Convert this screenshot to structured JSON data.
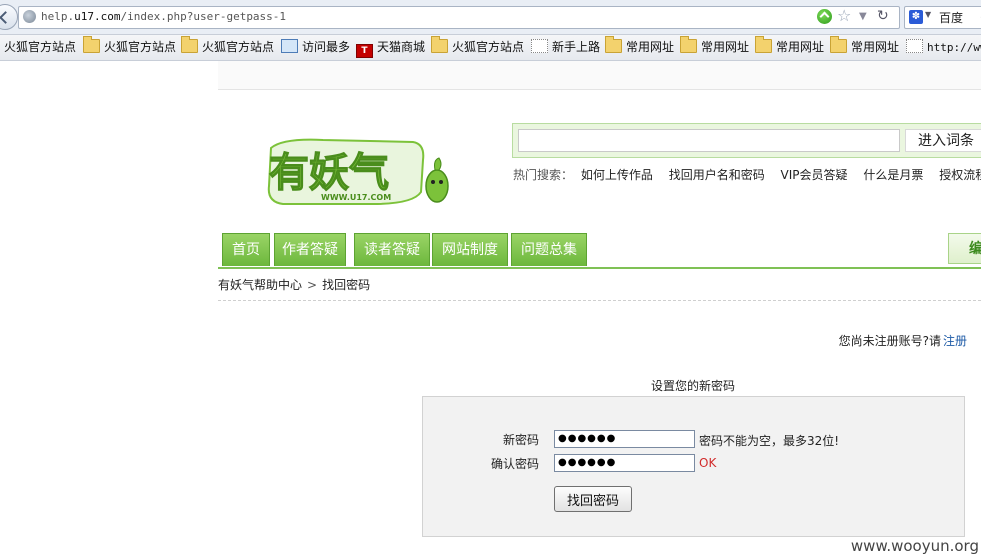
{
  "browser": {
    "url_prefix": "help.",
    "url_domain": "u17.com",
    "url_path": "/index.php?user-getpass-1",
    "search_engine": "百度",
    "search_extra": "《C"
  },
  "bookmarks": [
    {
      "label": "火狐官方站点",
      "icon": "folder-icon"
    },
    {
      "label": "火狐官方站点",
      "icon": "folder-icon"
    },
    {
      "label": "火狐官方站点",
      "icon": "folder-icon"
    },
    {
      "label": "访问最多",
      "icon": "magnifier-icon"
    },
    {
      "label": "天猫商城",
      "icon": "tmall-icon"
    },
    {
      "label": "火狐官方站点",
      "icon": "folder-icon"
    },
    {
      "label": "新手上路",
      "icon": "blank-page-icon"
    },
    {
      "label": "常用网址",
      "icon": "folder-icon"
    },
    {
      "label": "常用网址",
      "icon": "folder-icon"
    },
    {
      "label": "常用网址",
      "icon": "folder-icon"
    },
    {
      "label": "常用网址",
      "icon": "folder-icon"
    },
    {
      "label": "http://www",
      "icon": "blank-page-icon"
    }
  ],
  "logo": {
    "brand": "有妖气",
    "domain": "WWW.U17.COM",
    "color": "#7cc23a"
  },
  "search": {
    "input_value": "",
    "button_label": "进入词条"
  },
  "hot_search": {
    "label": "热门搜索：",
    "items": [
      "如何上传作品",
      "找回用户名和密码",
      "VIP会员答疑",
      "什么是月票",
      "授权流程"
    ]
  },
  "nav": {
    "tabs": [
      "首页",
      "作者答疑",
      "读者答疑",
      "网站制度",
      "问题总集"
    ],
    "edit_label": "编"
  },
  "breadcrumb": {
    "home": "有妖气帮助中心",
    "separator": ">",
    "current": "找回密码"
  },
  "register": {
    "prompt": "您尚未注册账号?请",
    "link": "注册"
  },
  "form": {
    "title": "设置您的新密码",
    "new_password_label": "新密码",
    "new_password_value": "●●●●●●",
    "new_password_hint": "密码不能为空，最多32位!",
    "confirm_label": "确认密码",
    "confirm_value": "●●●●●●",
    "confirm_status": "OK",
    "submit_label": "找回密码"
  },
  "watermark": "www.wooyun.org",
  "colors": {
    "nav_green": "#7cc23a",
    "ok_red": "#d12b2b",
    "link_blue": "#1d5aa6"
  }
}
